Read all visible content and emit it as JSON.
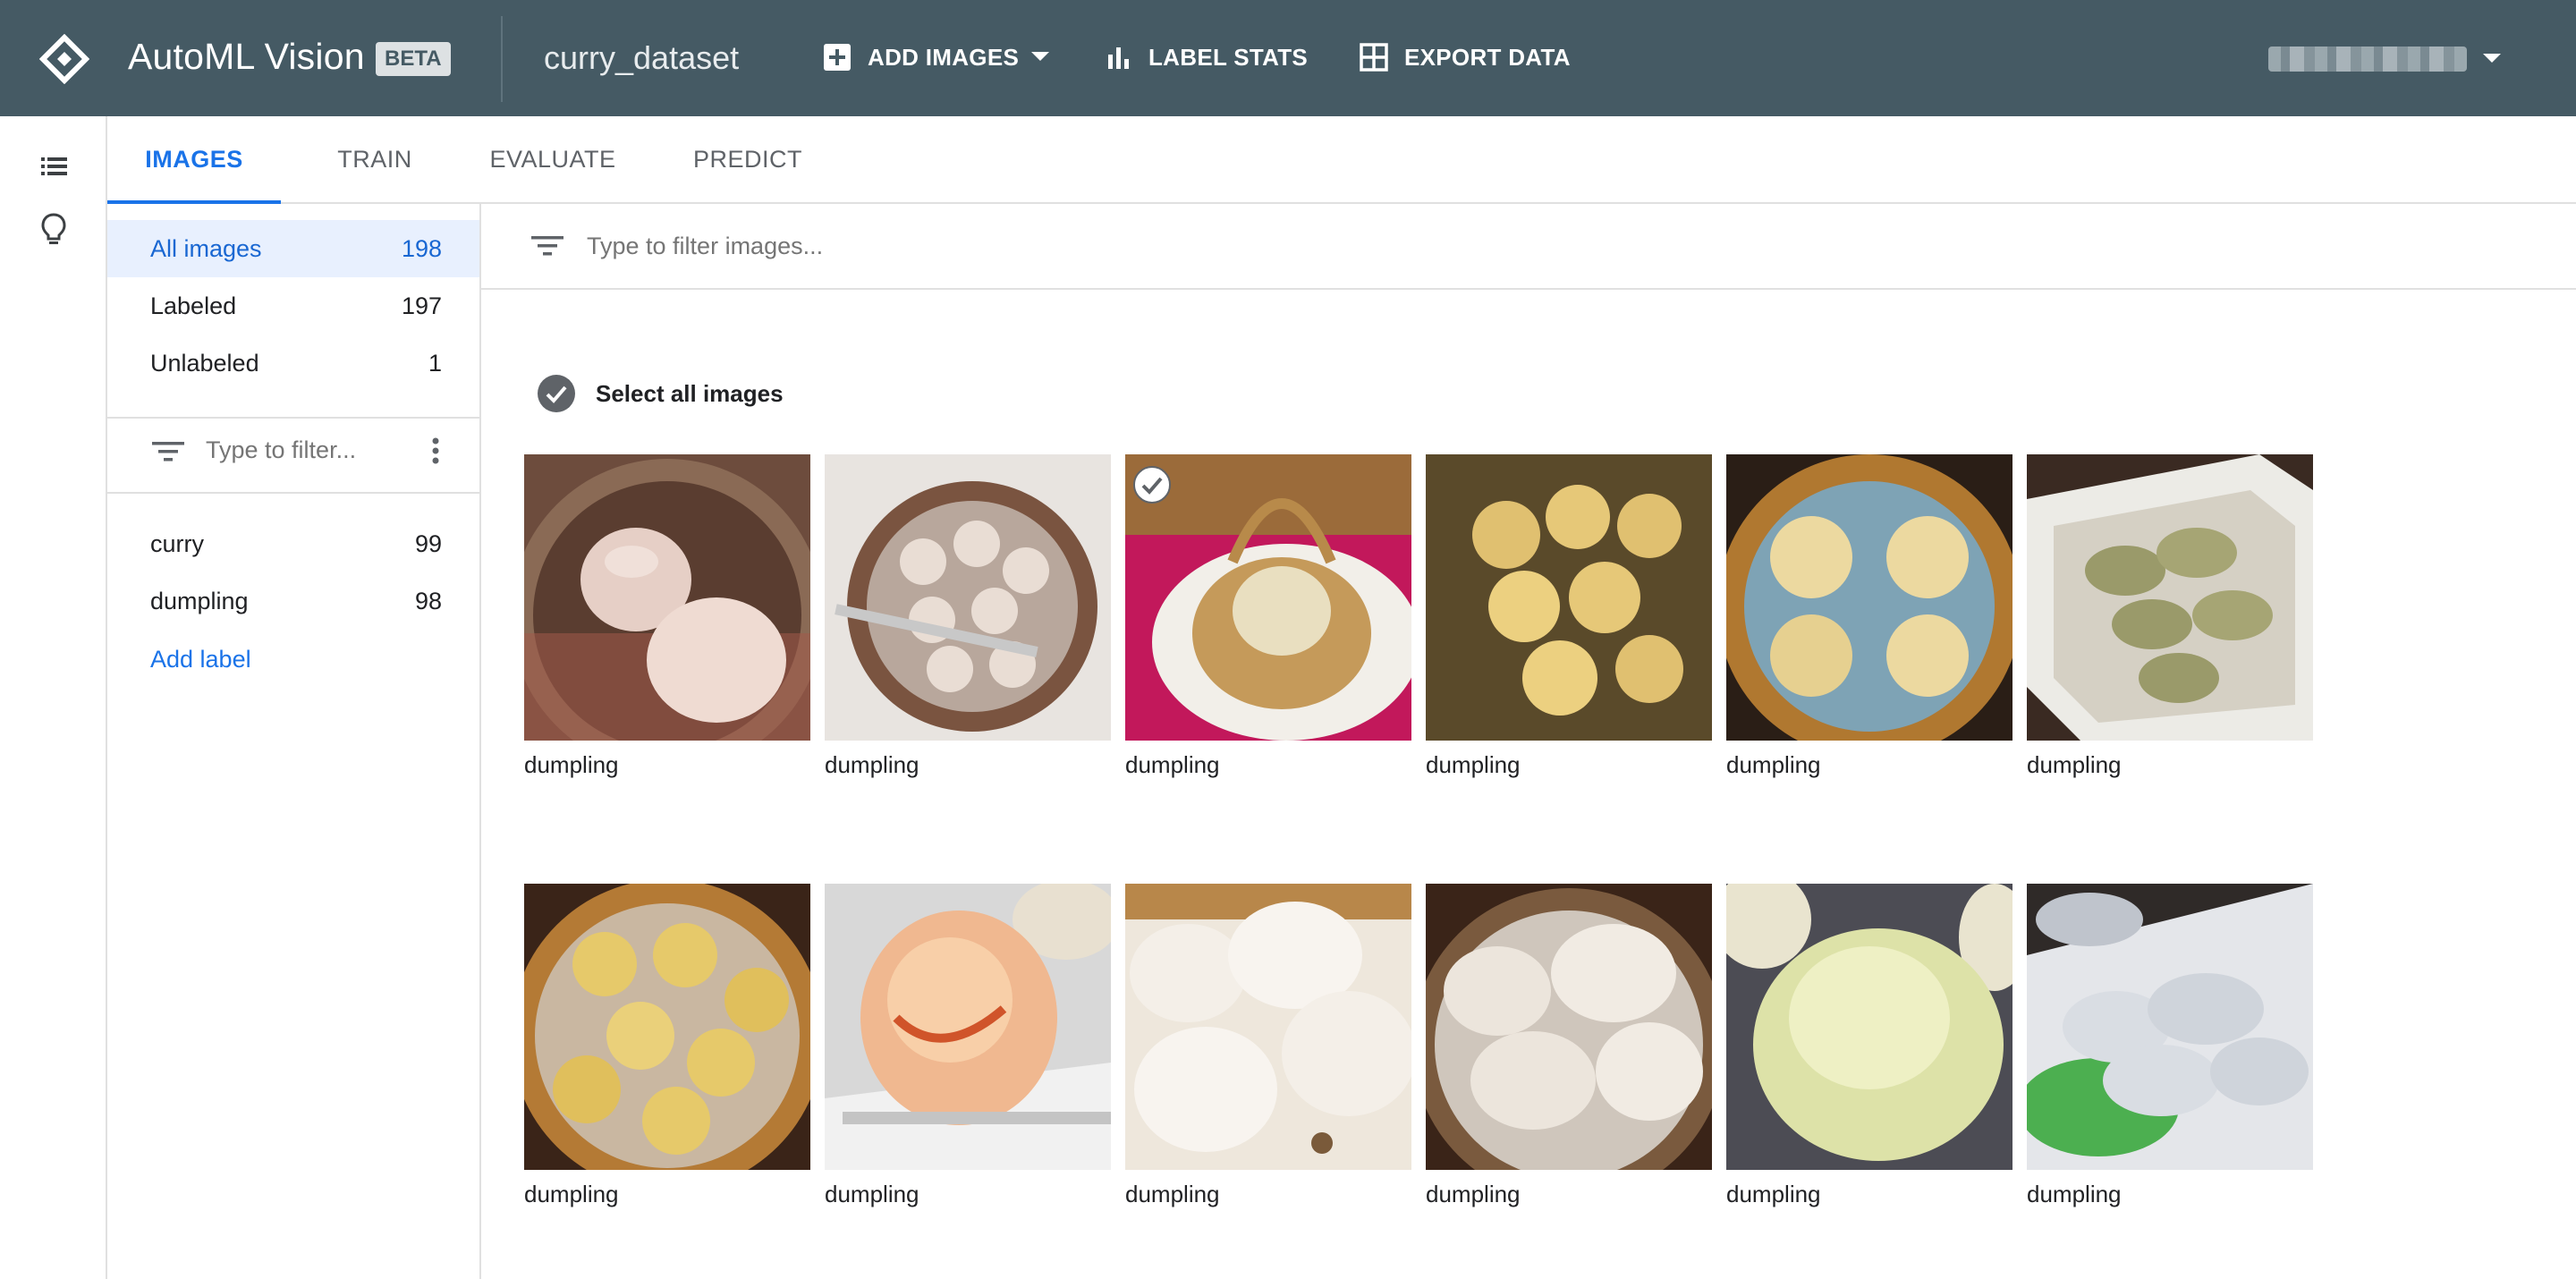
{
  "app": {
    "title": "AutoML Vision",
    "badge": "BETA",
    "dataset": "curry_dataset"
  },
  "toolbar": {
    "add_images": "ADD IMAGES",
    "label_stats": "LABEL STATS",
    "export_data": "EXPORT DATA"
  },
  "tabs": [
    "IMAGES",
    "TRAIN",
    "EVALUATE",
    "PREDICT"
  ],
  "filters": [
    {
      "label": "All images",
      "count": "198"
    },
    {
      "label": "Labeled",
      "count": "197"
    },
    {
      "label": "Unlabeled",
      "count": "1"
    }
  ],
  "label_filter_placeholder": "Type to filter...",
  "labels": [
    {
      "name": "curry",
      "count": "99"
    },
    {
      "name": "dumpling",
      "count": "98"
    }
  ],
  "add_label": "Add label",
  "image_filter_placeholder": "Type to filter images...",
  "select_all": "Select all images",
  "images": [
    {
      "label": "dumpling",
      "selected": false
    },
    {
      "label": "dumpling",
      "selected": false
    },
    {
      "label": "dumpling",
      "selected": true
    },
    {
      "label": "dumpling",
      "selected": false
    },
    {
      "label": "dumpling",
      "selected": false
    },
    {
      "label": "dumpling",
      "selected": false
    },
    {
      "label": "dumpling",
      "selected": false
    },
    {
      "label": "dumpling",
      "selected": false
    },
    {
      "label": "dumpling",
      "selected": false
    },
    {
      "label": "dumpling",
      "selected": false
    },
    {
      "label": "dumpling",
      "selected": false
    },
    {
      "label": "dumpling",
      "selected": false
    }
  ],
  "colors": {
    "header": "#455a64",
    "accent": "#1a73e8",
    "selected_bg": "#e8f0fe"
  }
}
